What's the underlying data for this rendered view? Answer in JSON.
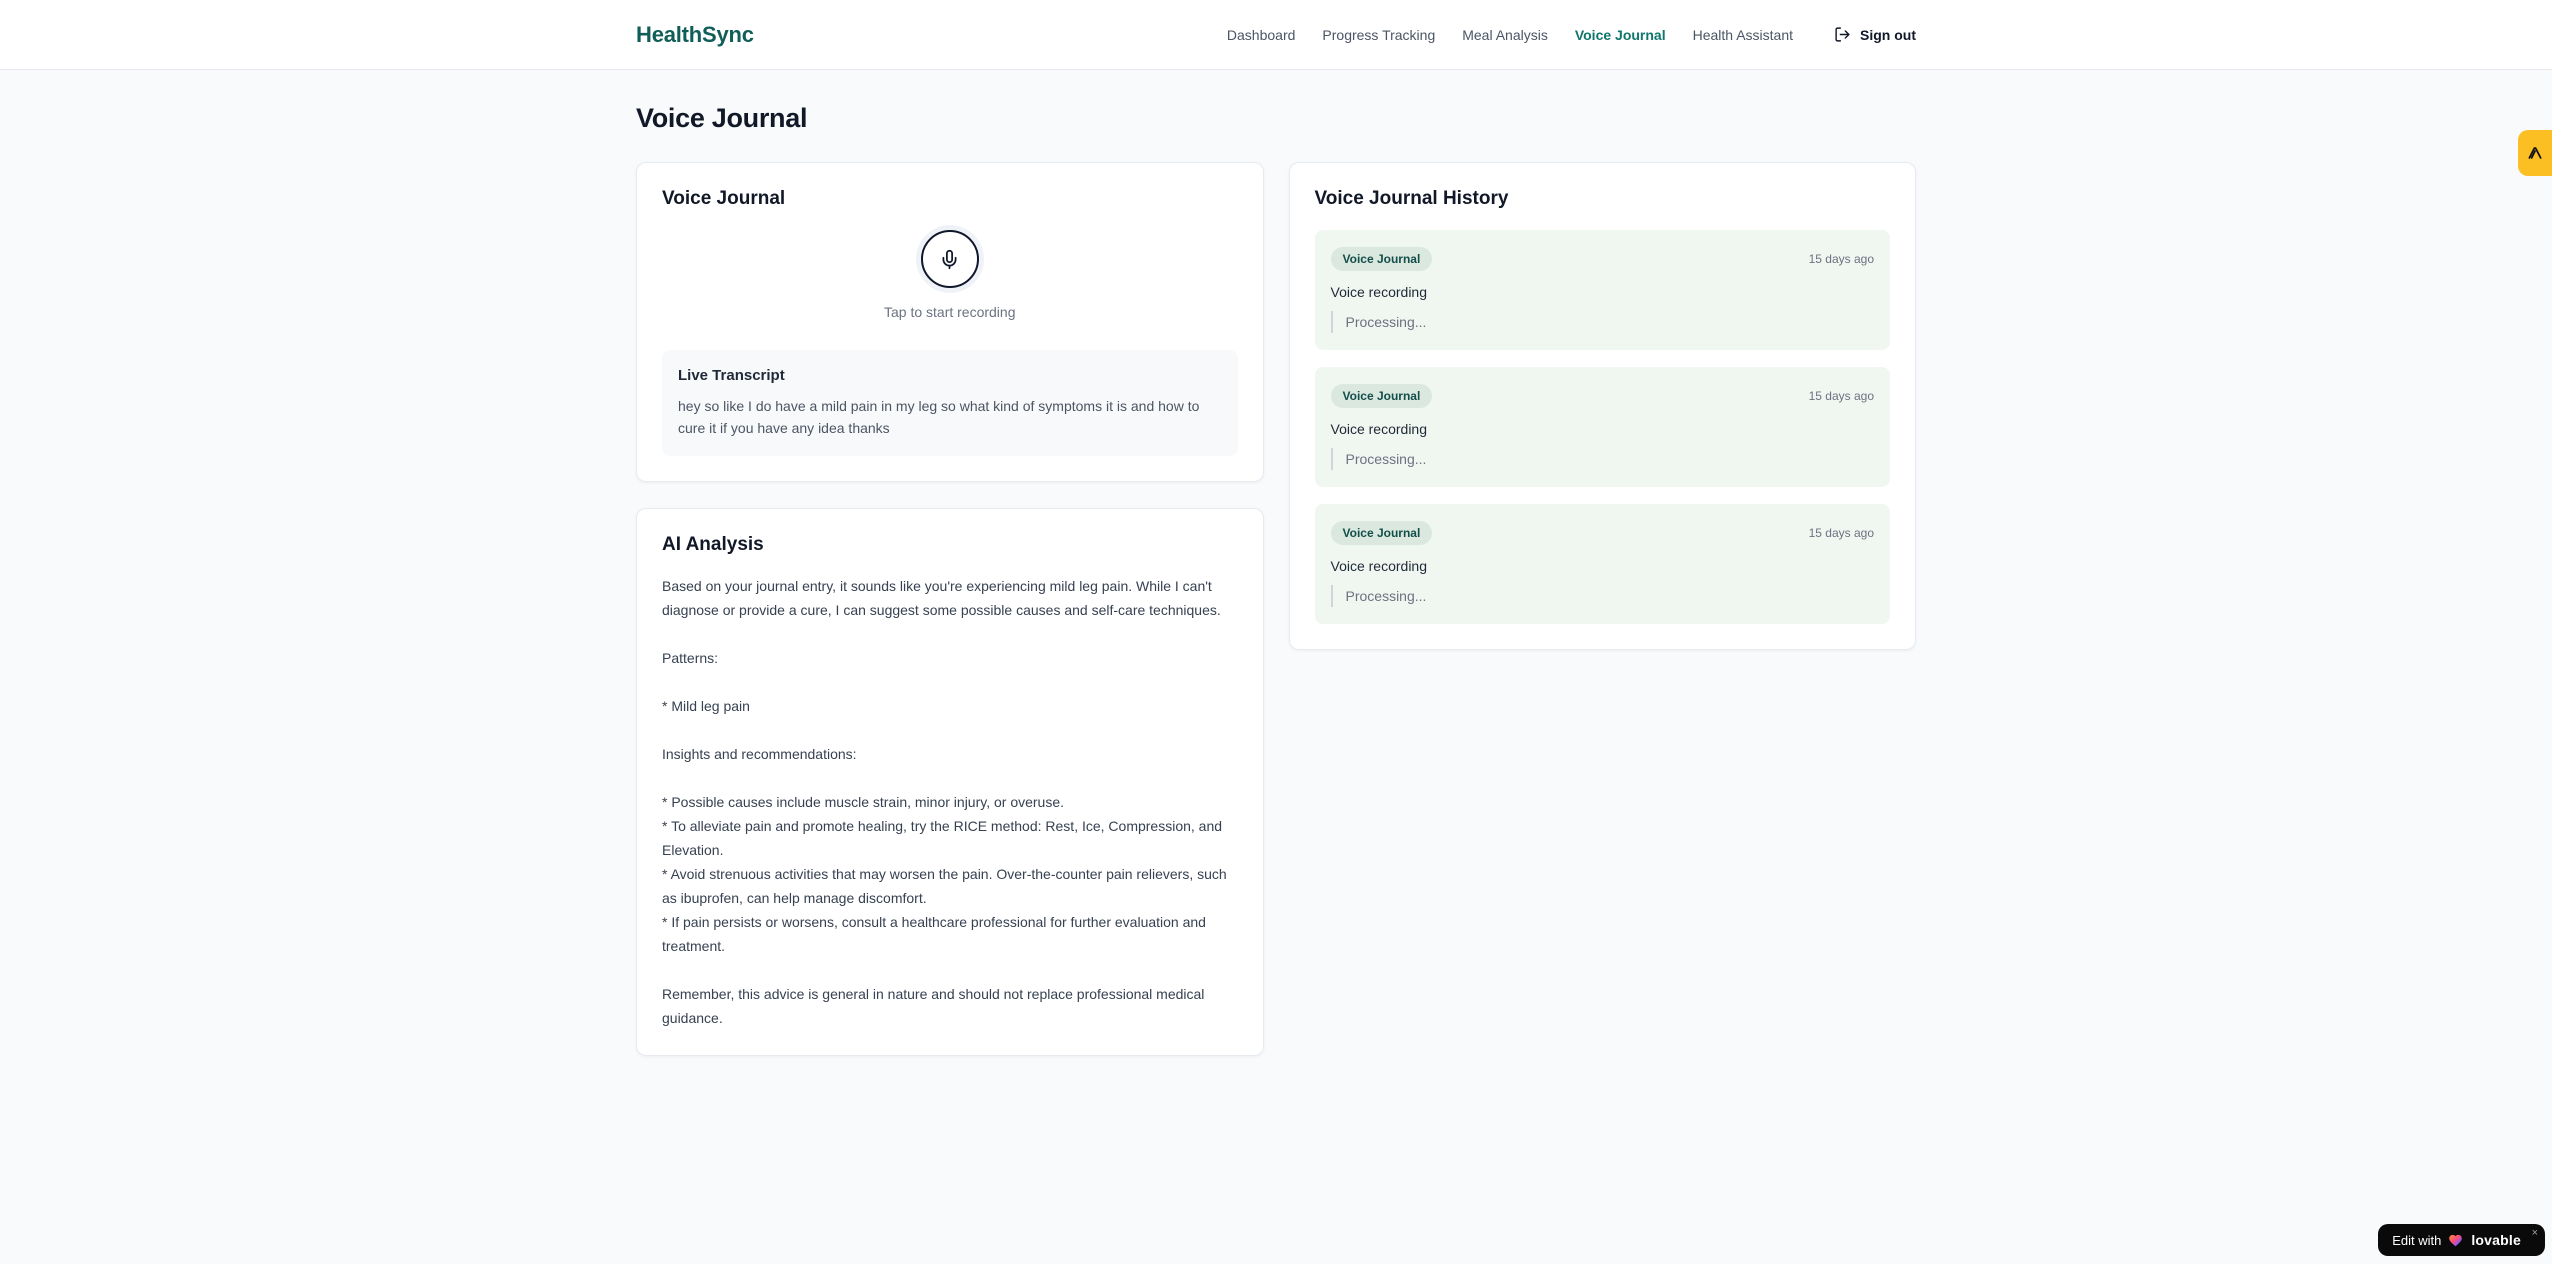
{
  "header": {
    "logo": "HealthSync",
    "nav": [
      {
        "label": "Dashboard",
        "active": false
      },
      {
        "label": "Progress Tracking",
        "active": false
      },
      {
        "label": "Meal Analysis",
        "active": false
      },
      {
        "label": "Voice Journal",
        "active": true
      },
      {
        "label": "Health Assistant",
        "active": false
      }
    ],
    "sign_out_label": "Sign out"
  },
  "page": {
    "title": "Voice Journal"
  },
  "recorder_card": {
    "title": "Voice Journal",
    "tap_hint": "Tap to start recording",
    "transcript_title": "Live Transcript",
    "transcript_text": "hey so like I do have a mild pain in my leg so what kind of symptoms it is and how to cure it if you have any idea thanks"
  },
  "analysis_card": {
    "title": "AI Analysis",
    "body": "Based on your journal entry, it sounds like you're experiencing mild leg pain. While I can't diagnose or provide a cure, I can suggest some possible causes and self-care techniques.\n\nPatterns:\n\n* Mild leg pain\n\nInsights and recommendations:\n\n* Possible causes include muscle strain, minor injury, or overuse.\n* To alleviate pain and promote healing, try the RICE method: Rest, Ice, Compression, and Elevation.\n* Avoid strenuous activities that may worsen the pain. Over-the-counter pain relievers, such as ibuprofen, can help manage discomfort.\n* If pain persists or worsens, consult a healthcare professional for further evaluation and treatment.\n\nRemember, this advice is general in nature and should not replace professional medical guidance."
  },
  "history_card": {
    "title": "Voice Journal History",
    "entries": [
      {
        "badge": "Voice Journal",
        "time": "15 days ago",
        "label": "Voice recording",
        "status": "Processing..."
      },
      {
        "badge": "Voice Journal",
        "time": "15 days ago",
        "label": "Voice recording",
        "status": "Processing..."
      },
      {
        "badge": "Voice Journal",
        "time": "15 days ago",
        "label": "Voice recording",
        "status": "Processing..."
      }
    ]
  },
  "lovable_badge": {
    "prefix": "Edit with",
    "brand": "lovable",
    "close": "×"
  },
  "colors": {
    "logo": "#115e59",
    "nav_active": "#0f766e",
    "page_bg": "#f8fafc",
    "entry_bg": "#f0f7f1",
    "badge_bg": "#dbe8df",
    "badge_text": "#134e4a",
    "side_tab": "#fbbf24",
    "lovable_bg": "#0a0a0a"
  }
}
